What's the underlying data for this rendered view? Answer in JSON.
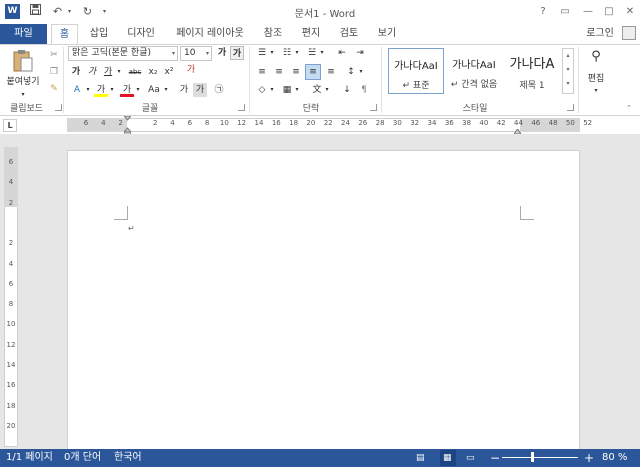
{
  "titlebar": {
    "logo_letter": "W",
    "title": "문서1 - Word",
    "undo_icon": "undo-icon",
    "redo_icon": "redo-icon",
    "save_icon": "save-icon",
    "help": "?",
    "restore": "▭",
    "minimize": "—",
    "maximize": "□",
    "close": "✕"
  },
  "tabs": {
    "file": "파일",
    "items": [
      "홈",
      "삽입",
      "디자인",
      "페이지 레이아웃",
      "참조",
      "편지",
      "검토",
      "보기"
    ],
    "signin": "로그인"
  },
  "ribbon": {
    "clipboard": {
      "paste": "붙여넣기",
      "label": "클립보드"
    },
    "font": {
      "name": "맑은 고딕(본문 한글)",
      "size": "10",
      "grow": "가",
      "shrink": "가",
      "bold": "가",
      "italic": "가",
      "underline": "가",
      "strike": "abc",
      "sub": "x₂",
      "sup": "x²",
      "clear": "가",
      "highlight": "가",
      "fontcolor": "가",
      "case": "Aa",
      "enlarge": "가",
      "shade": "가",
      "circle": "㉠",
      "label": "글꼴"
    },
    "paragraph": {
      "label": "단락"
    },
    "styles": {
      "items": [
        {
          "sample": "가나다AaI",
          "name": "↵ 표준"
        },
        {
          "sample": "가나다AaI",
          "name": "↵ 간격 없음"
        },
        {
          "sample": "가나다A",
          "name": "제목 1"
        }
      ],
      "label": "스타일"
    },
    "editing": {
      "label": "편집"
    }
  },
  "ruler": {
    "corner": "L",
    "numbers": [
      "6",
      "4",
      "2",
      "",
      "2",
      "4",
      "6",
      "8",
      "10",
      "12",
      "14",
      "16",
      "18",
      "20",
      "22",
      "24",
      "26",
      "28",
      "30",
      "32",
      "34",
      "36",
      "38",
      "40",
      "42",
      "44",
      "46",
      "48",
      "50",
      "52"
    ]
  },
  "vruler": {
    "numbers": [
      "6",
      "4",
      "2",
      "",
      "2",
      "4",
      "6",
      "8",
      "10",
      "12",
      "14",
      "16",
      "18",
      "20"
    ]
  },
  "document": {
    "paragraph_mark": "↵"
  },
  "status": {
    "page": "1/1 페이지",
    "words": "0개 단어",
    "language": "한국어",
    "zoom": "80 %",
    "zoom_minus": "−",
    "zoom_plus": "+"
  },
  "colors": {
    "accent": "#2b579a"
  }
}
